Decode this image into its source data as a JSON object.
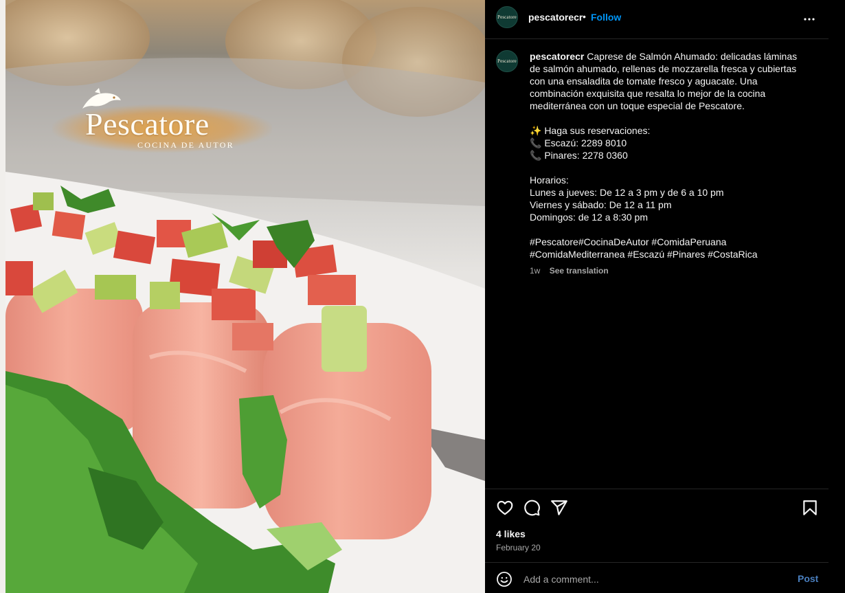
{
  "post": {
    "username": "pescatorecr",
    "follow_label": "Follow",
    "separator": "•",
    "avatar_text": "Pescatore"
  },
  "photo": {
    "brand_name": "Pescatore",
    "brand_tagline": "COCINA DE AUTOR"
  },
  "caption": {
    "username": "pescatorecr",
    "text": "Caprese de Salmón Ahumado: delicadas láminas de salmón ahumado, rellenas de mozzarella fresca y cubiertas con una ensaladita de tomate fresco y aguacate. Una combinación exquisita que resalta lo mejor de la cocina mediterránea con un toque especial de Pescatore.",
    "reservations_title": "✨ Haga sus reservaciones:",
    "phone_1": "📞 Escazú: 2289 8010",
    "phone_2": "📞 Pinares: 2278 0360",
    "hours_title": "Horarios:",
    "hours_1": "Lunes a jueves: De 12 a 3 pm y de 6 a 10 pm",
    "hours_2": "Viernes y sábado: De 12 a 11 pm",
    "hours_3": "Domingos: de 12 a 8:30 pm",
    "hashtags_1": "#Pescatore#CocinaDeAutor #ComidaPeruana",
    "hashtags_2": "#ComidaMediterranea #Escazú #Pinares #CostaRica",
    "time_ago": "1w",
    "see_translation": "See translation"
  },
  "actions": {
    "likes": "4 likes",
    "date": "February 20",
    "icons": [
      "heart-icon",
      "comment-icon",
      "share-icon",
      "bookmark-icon"
    ]
  },
  "comment_box": {
    "placeholder": "Add a comment...",
    "post_label": "Post"
  },
  "colors": {
    "background": "#000000",
    "link_blue": "#0095f6",
    "muted_text": "#a8a8a8",
    "divider": "#262626",
    "post_button_inactive": "#4a7fbf"
  }
}
